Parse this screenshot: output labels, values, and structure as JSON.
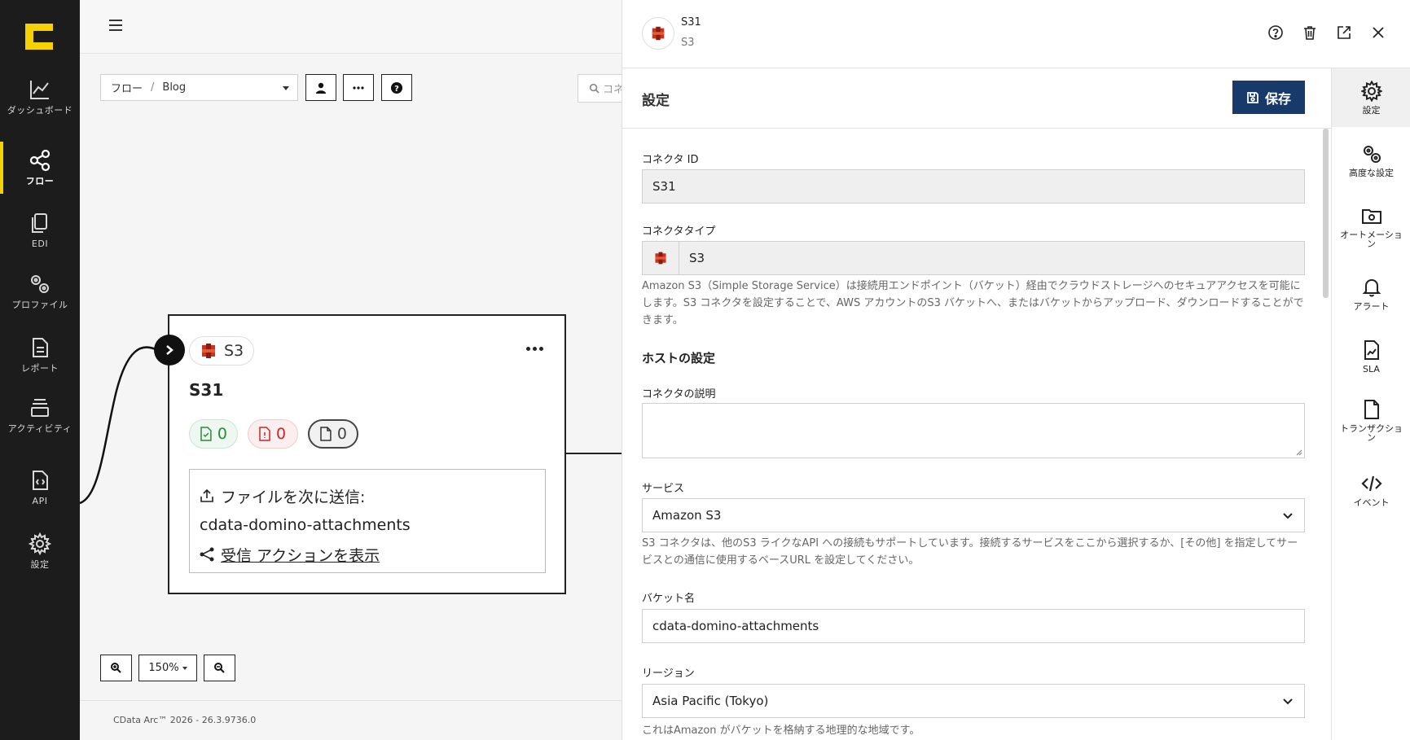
{
  "nav": {
    "logo": "cdata-logo",
    "items": [
      {
        "label": "ダッシュボード",
        "icon": "dashboard-icon"
      },
      {
        "label": "フロー",
        "icon": "flow-icon",
        "active": true
      },
      {
        "label": "EDI",
        "icon": "edi-icon"
      },
      {
        "label": "プロファイル",
        "icon": "profile-icon"
      },
      {
        "label": "レポート",
        "icon": "report-icon"
      },
      {
        "label": "アクティビティ",
        "icon": "activity-icon"
      },
      {
        "label": "API",
        "icon": "api-icon"
      },
      {
        "label": "設定",
        "icon": "settings-icon"
      }
    ],
    "accent": "#f5d100"
  },
  "canvas": {
    "breadcrumb": {
      "root": "フロー",
      "sep": "/",
      "current": "Blog"
    },
    "search_placeholder": "コネ",
    "node": {
      "type_label": "S3",
      "title": "S31",
      "success_count": "0",
      "error_count": "0",
      "pending_count": "0",
      "send_label": "ファイルを次に送信:",
      "send_target": "cdata-domino-attachments",
      "receive_link": "受信 アクションを表示"
    },
    "zoom": "150%",
    "footer": "CData Arc™ 2026 - 26.3.9736.0"
  },
  "panel": {
    "title": "S31",
    "subtitle": "S3",
    "section_title": "設定",
    "save_label": "保存",
    "save_color": "#173a6a",
    "fields": {
      "connector_id_label": "コネクタ ID",
      "connector_id_value": "S31",
      "connector_type_label": "コネクタタイプ",
      "connector_type_value": "S3",
      "connector_type_help": "Amazon S3（Simple Storage Service）は接続用エンドポイント（バケット）経由でクラウドストレージへのセキュアアクセスを可能にします。S3 コネクタを設定することで、AWS アカウントのS3 バケットへ、またはバケットからアップロード、ダウンロードすることができます。",
      "host_heading": "ホストの設定",
      "description_label": "コネクタの説明",
      "description_value": "",
      "service_label": "サービス",
      "service_value": "Amazon S3",
      "service_help": "S3 コネクタは、他のS3 ライクなAPI への接続もサポートしています。接続するサービスをここから選択するか、[その他] を指定してサービスとの通信に使用するベースURL を設定してください。",
      "bucket_label": "バケット名",
      "bucket_value": "cdata-domino-attachments",
      "region_label": "リージョン",
      "region_value": "Asia Pacific (Tokyo)",
      "region_help": "これはAmazon がバケットを格納する地理的な地域です。"
    },
    "rail": [
      {
        "label": "設定",
        "icon": "gear-icon",
        "active": true
      },
      {
        "label": "高度な設定",
        "icon": "gears-icon"
      },
      {
        "label": "オートメーション",
        "icon": "automation-icon"
      },
      {
        "label": "アラート",
        "icon": "bell-icon"
      },
      {
        "label": "SLA",
        "icon": "sla-icon"
      },
      {
        "label": "トランザクション",
        "icon": "transaction-icon"
      },
      {
        "label": "イベント",
        "icon": "code-icon"
      }
    ]
  }
}
